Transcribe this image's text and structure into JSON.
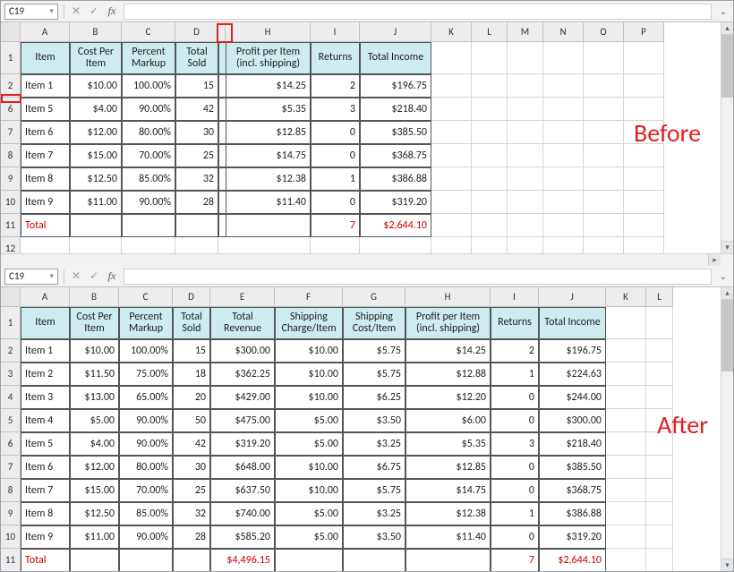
{
  "annotations": {
    "before": "Before",
    "after": "After"
  },
  "fbar": {
    "cell_ref": "C19",
    "x_icon": "✕",
    "check_icon": "✓",
    "fx": "fx"
  },
  "before": {
    "cols": [
      "A",
      "B",
      "C",
      "D",
      "",
      "H",
      "I",
      "J",
      "K",
      "L",
      "M",
      "N",
      "O",
      "P"
    ],
    "rows_visible": [
      "1",
      "2",
      "6",
      "7",
      "8",
      "9",
      "10",
      "11",
      "12"
    ],
    "headers": [
      "Item",
      "Cost Per Item",
      "Percent Markup",
      "Total Sold",
      "",
      "Profit per Item (incl. shipping)",
      "Returns",
      "Total Income"
    ],
    "data": [
      [
        "Item 1",
        "$10.00",
        "100.00%",
        "15",
        "",
        "$14.25",
        "2",
        "$196.75"
      ],
      [
        "Item 5",
        "$4.00",
        "90.00%",
        "42",
        "",
        "$5.35",
        "3",
        "$218.40"
      ],
      [
        "Item 6",
        "$12.00",
        "80.00%",
        "30",
        "",
        "$12.85",
        "0",
        "$385.50"
      ],
      [
        "Item 7",
        "$15.00",
        "70.00%",
        "25",
        "",
        "$14.75",
        "0",
        "$368.75"
      ],
      [
        "Item 8",
        "$12.50",
        "85.00%",
        "32",
        "",
        "$12.38",
        "1",
        "$386.88"
      ],
      [
        "Item 9",
        "$11.00",
        "90.00%",
        "28",
        "",
        "$11.40",
        "0",
        "$319.20"
      ]
    ],
    "total_row": [
      "Total",
      "",
      "",
      "",
      "",
      "",
      "7",
      "$2,644.10"
    ]
  },
  "after": {
    "cols": [
      "A",
      "B",
      "C",
      "D",
      "E",
      "F",
      "G",
      "H",
      "I",
      "J",
      "K",
      "L"
    ],
    "rows_visible": [
      "1",
      "2",
      "3",
      "4",
      "5",
      "6",
      "7",
      "8",
      "9",
      "10",
      "11"
    ],
    "headers": [
      "Item",
      "Cost Per Item",
      "Percent Markup",
      "Total Sold",
      "Total Revenue",
      "Shipping Charge/Item",
      "Shipping Cost/Item",
      "Profit per Item (incl. shipping)",
      "Returns",
      "Total Income"
    ],
    "data": [
      [
        "Item 1",
        "$10.00",
        "100.00%",
        "15",
        "$300.00",
        "$10.00",
        "$5.75",
        "$14.25",
        "2",
        "$196.75"
      ],
      [
        "Item 2",
        "$11.50",
        "75.00%",
        "18",
        "$362.25",
        "$10.00",
        "$5.75",
        "$12.88",
        "1",
        "$224.63"
      ],
      [
        "Item 3",
        "$13.00",
        "65.00%",
        "20",
        "$429.00",
        "$10.00",
        "$6.25",
        "$12.20",
        "0",
        "$244.00"
      ],
      [
        "Item 4",
        "$5.00",
        "90.00%",
        "50",
        "$475.00",
        "$5.00",
        "$3.50",
        "$6.00",
        "0",
        "$300.00"
      ],
      [
        "Item 5",
        "$4.00",
        "90.00%",
        "42",
        "$319.20",
        "$5.00",
        "$3.25",
        "$5.35",
        "3",
        "$218.40"
      ],
      [
        "Item 6",
        "$12.00",
        "80.00%",
        "30",
        "$648.00",
        "$10.00",
        "$6.75",
        "$12.85",
        "0",
        "$385.50"
      ],
      [
        "Item 7",
        "$15.00",
        "70.00%",
        "25",
        "$637.50",
        "$10.00",
        "$5.75",
        "$14.75",
        "0",
        "$368.75"
      ],
      [
        "Item 8",
        "$12.50",
        "85.00%",
        "32",
        "$740.00",
        "$5.00",
        "$3.25",
        "$12.38",
        "1",
        "$386.88"
      ],
      [
        "Item 9",
        "$11.00",
        "90.00%",
        "28",
        "$585.20",
        "$5.00",
        "$3.50",
        "$11.40",
        "0",
        "$319.20"
      ]
    ],
    "total_row": [
      "Total",
      "",
      "",
      "",
      "$4,496.15",
      "",
      "",
      "",
      "7",
      "$2,644.10"
    ]
  }
}
